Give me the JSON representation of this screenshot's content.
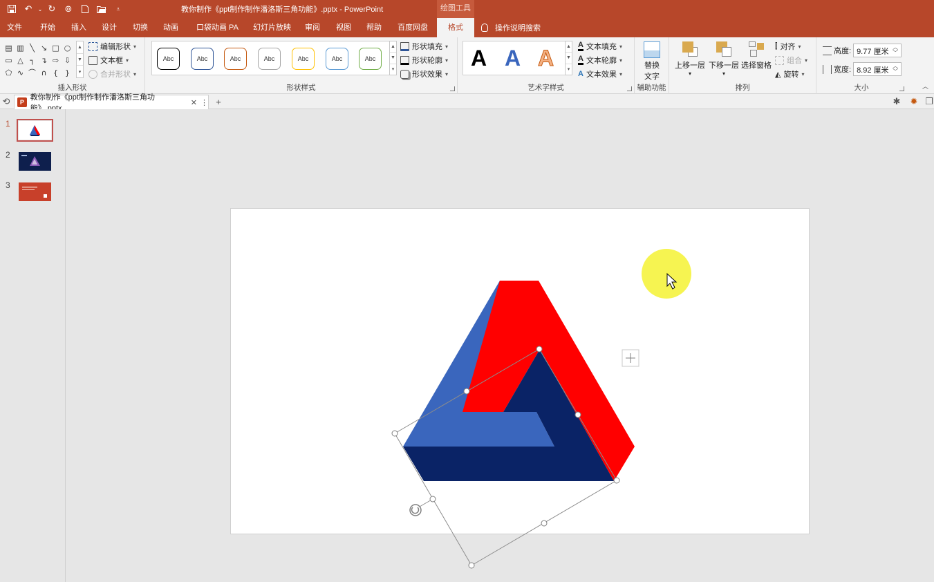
{
  "window": {
    "title": "教你制作《ppt制作制作潘洛斯三角功能》.pptx  -  PowerPoint",
    "context_tool": "绘图工具"
  },
  "tabs": [
    "文件",
    "开始",
    "插入",
    "设计",
    "切换",
    "动画",
    "口袋动画 PA",
    "幻灯片放映",
    "审阅",
    "视图",
    "帮助",
    "百度网盘",
    "格式"
  ],
  "active_tab": "格式",
  "tell_me": "操作说明搜索",
  "ribbon": {
    "insert_shapes": {
      "label": "插入形状",
      "edit_shape": "编辑形状",
      "text_box": "文本框",
      "merge_shapes": "合并形状"
    },
    "shape_styles": {
      "label": "形状样式",
      "swatch_text": "Abc",
      "swatch_colors": [
        "#000000",
        "#2f5597",
        "#c55a11",
        "#7f7f7f",
        "#bf9000",
        "#2e75b6",
        "#548235"
      ],
      "fill": "形状填充",
      "outline": "形状轮廓",
      "effects": "形状效果"
    },
    "wordart_styles": {
      "label": "艺术字样式",
      "sample": "A",
      "fill": "文本填充",
      "outline": "文本轮廓",
      "effects": "文本效果"
    },
    "accessibility": {
      "label": "辅助功能",
      "alt_text_line1": "替换",
      "alt_text_line2": "文字"
    },
    "arrange": {
      "label": "排列",
      "bring_forward": "上移一层",
      "send_backward": "下移一层",
      "selection_pane": "选择窗格",
      "align": "对齐",
      "group": "组合",
      "rotate": "旋转"
    },
    "size": {
      "label": "大小",
      "height_label": "高度:",
      "height_value": "9.77 厘米",
      "width_label": "宽度:",
      "width_value": "8.92 厘米"
    }
  },
  "document_tab": {
    "name": "教你制作《ppt制作制作潘洛斯三角功能》.pptx",
    "icon_letter": "P"
  },
  "slides": [
    {
      "number": "1",
      "selected": true
    },
    {
      "number": "2",
      "selected": false
    },
    {
      "number": "3",
      "selected": false
    }
  ],
  "colors": {
    "accent": "#b7472a",
    "triangle_blue": "#3a66bd",
    "triangle_red": "#ff0000",
    "triangle_navy": "#0a2366",
    "cursor_highlight": "#f5f232"
  }
}
